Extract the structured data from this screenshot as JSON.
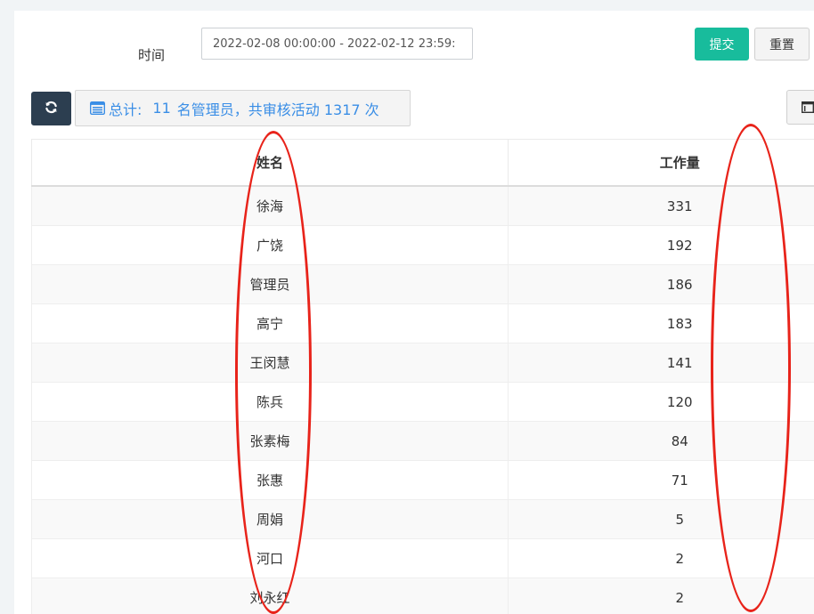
{
  "filter": {
    "time_label": "时间",
    "date_range_value": "2022-02-08 00:00:00 - 2022-02-12 23:59:",
    "submit_label": "提交",
    "reset_label": "重置"
  },
  "toolbar": {
    "summary_prefix": "总计:",
    "summary_count": "11",
    "summary_rest": "名管理员，共审核活动 1317 次"
  },
  "table": {
    "headers": [
      "姓名",
      "工作量"
    ],
    "rows": [
      {
        "name": "徐海",
        "workload": "331"
      },
      {
        "name": "广饶",
        "workload": "192"
      },
      {
        "name": "管理员",
        "workload": "186"
      },
      {
        "name": "高宁",
        "workload": "183"
      },
      {
        "name": "王闵慧",
        "workload": "141"
      },
      {
        "name": "陈兵",
        "workload": "120"
      },
      {
        "name": "张素梅",
        "workload": "84"
      },
      {
        "name": "张惠",
        "workload": "71"
      },
      {
        "name": "周娟",
        "workload": "5"
      },
      {
        "name": "河口",
        "workload": "2"
      },
      {
        "name": "刘永红",
        "workload": "2"
      }
    ]
  },
  "icons": {
    "refresh": "refresh-icon",
    "summary": "list-icon",
    "columns": "columns-icon"
  },
  "colors": {
    "submit": "#18bc9c",
    "refresh": "#2c3e50",
    "summary_text": "#3a8ee6",
    "annotation": "#e8231a"
  }
}
